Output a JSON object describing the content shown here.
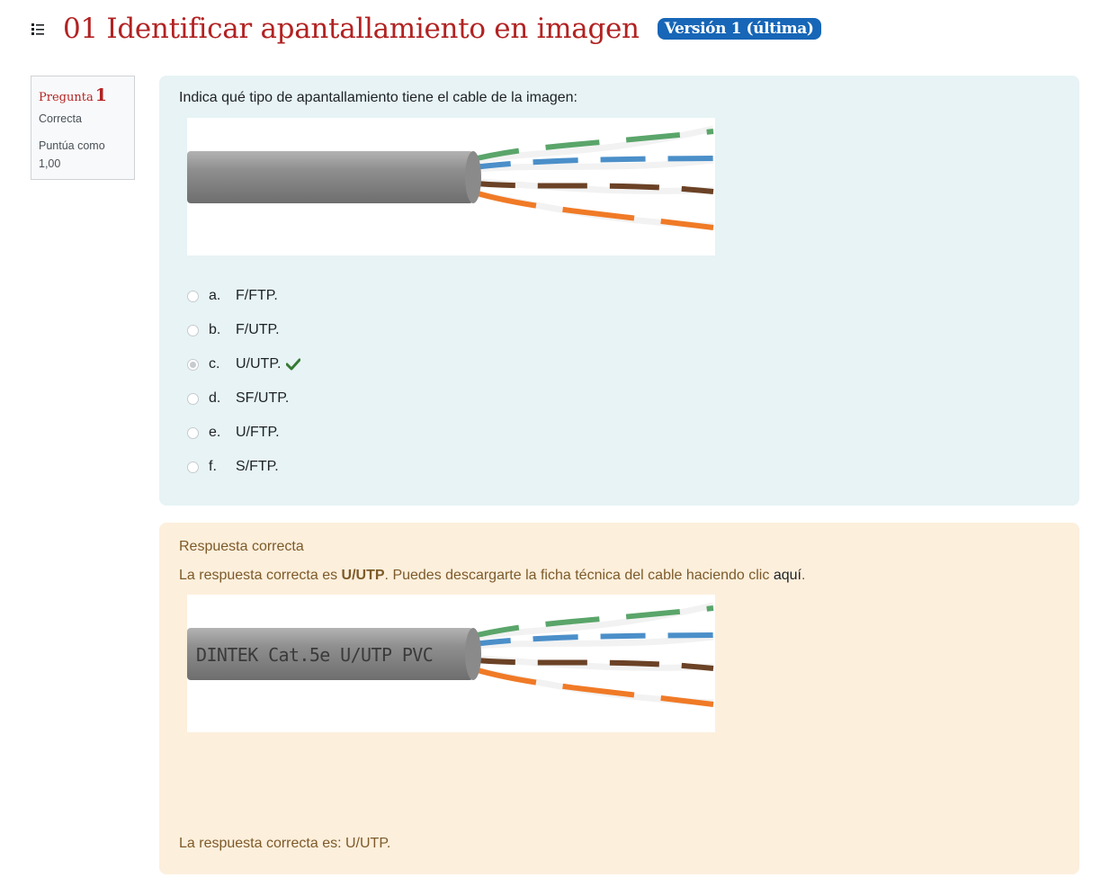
{
  "header": {
    "title": "01 Identificar apantallamiento en imagen",
    "version_badge": "Versión 1 (última)"
  },
  "question_info": {
    "label": "Pregunta",
    "number": "1",
    "state": "Correcta",
    "grade": "Puntúa como 1,00"
  },
  "question": {
    "text": "Indica qué tipo de apantallamiento tiene el cable de la imagen:",
    "options": [
      {
        "letter": "a.",
        "text": "F/FTP.",
        "selected": false
      },
      {
        "letter": "b.",
        "text": "F/UTP.",
        "selected": false
      },
      {
        "letter": "c.",
        "text": "U/UTP.",
        "selected": true,
        "correct": true
      },
      {
        "letter": "d.",
        "text": "SF/UTP.",
        "selected": false
      },
      {
        "letter": "e.",
        "text": "U/FTP.",
        "selected": false
      },
      {
        "letter": "f.",
        "text": "S/FTP.",
        "selected": false
      }
    ]
  },
  "feedback": {
    "title": "Respuesta correcta",
    "text_before": "La respuesta correcta es ",
    "answer_bold": "U/UTP",
    "text_after": ". Puedes descargarte la ficha técnica del cable haciendo clic ",
    "link": "aquí",
    "text_end": ".",
    "cable_print": "DINTEK Cat.5e U/UTP PVC",
    "right_answer": "La respuesta correcta es: U/UTP."
  },
  "colors": {
    "title": "#b22222",
    "badge": "#1766b7",
    "formulation_bg": "#e7f3f5",
    "feedback_bg": "#fcefdc",
    "feedback_text": "#7d5a29",
    "correct_check": "#357a32"
  },
  "icons": {
    "header": "list-icon",
    "correct": "check-icon",
    "cable": "cable-photo"
  }
}
